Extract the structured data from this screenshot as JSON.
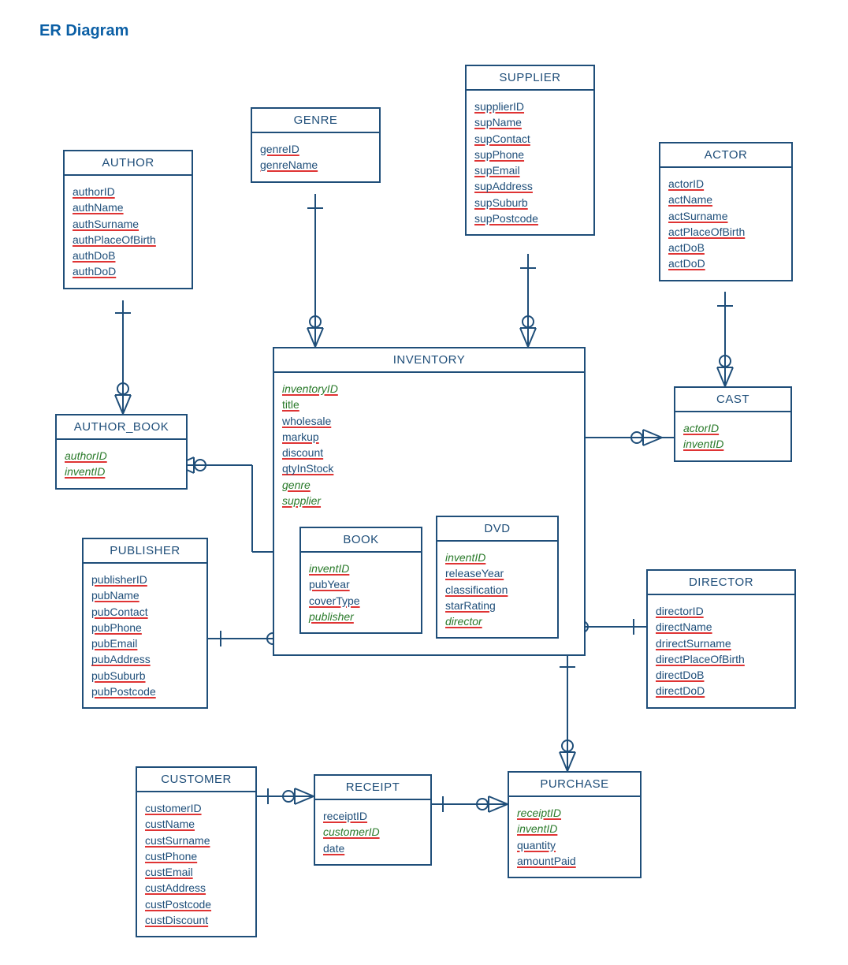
{
  "title": "ER Diagram",
  "entities": {
    "author": {
      "name": "AUTHOR",
      "attrs": [
        "authorID",
        "authName",
        "authSurname",
        "authPlaceOfBirth",
        "authDoB",
        "authDoD"
      ]
    },
    "genre": {
      "name": "GENRE",
      "attrs": [
        "genreID",
        "genreName"
      ]
    },
    "supplier": {
      "name": "SUPPLIER",
      "attrs": [
        "supplierID",
        "supName",
        "supContact",
        "supPhone",
        "supEmail",
        "supAddress",
        "supSuburb",
        "supPostcode"
      ]
    },
    "actor": {
      "name": "ACTOR",
      "attrs": [
        "actorID",
        "actName",
        "actSurname",
        "actPlaceOfBirth",
        "actDoB",
        "actDoD"
      ]
    },
    "author_book": {
      "name": "AUTHOR_BOOK",
      "attrs": [
        "authorID",
        "inventID"
      ]
    },
    "inventory": {
      "name": "INVENTORY",
      "attrs": [
        "inventoryID",
        "title",
        "wholesale",
        "markup",
        "discount",
        "qtyInStock",
        "genre",
        "supplier"
      ]
    },
    "book": {
      "name": "BOOK",
      "attrs": [
        "inventID",
        "pubYear",
        "coverType",
        "publisher"
      ]
    },
    "dvd": {
      "name": "DVD",
      "attrs": [
        "inventID",
        "releaseYear",
        "classification",
        "starRating",
        "director"
      ]
    },
    "cast": {
      "name": "CAST",
      "attrs": [
        "actorID",
        "inventID"
      ]
    },
    "publisher": {
      "name": "PUBLISHER",
      "attrs": [
        "publisherID",
        "pubName",
        "pubContact",
        "pubPhone",
        "pubEmail",
        "pubAddress",
        "pubSuburb",
        "pubPostcode"
      ]
    },
    "director": {
      "name": "DIRECTOR",
      "attrs": [
        "directorID",
        "directName",
        "drirectSurname",
        "directPlaceOfBirth",
        "directDoB",
        "directDoD"
      ]
    },
    "customer": {
      "name": "CUSTOMER",
      "attrs": [
        "customerID",
        "custName",
        "custSurname",
        "custPhone",
        "custEmail",
        "custAddress",
        "custPostcode",
        "custDiscount"
      ]
    },
    "receipt": {
      "name": "RECEIPT",
      "attrs": [
        "receiptID",
        "customerID",
        "date"
      ]
    },
    "purchase": {
      "name": "PURCHASE",
      "attrs": [
        "receiptID",
        "inventID",
        "quantity",
        "amountPaid"
      ]
    }
  },
  "chart_data": {
    "type": "diagram",
    "kind": "ER",
    "title": "ER Diagram",
    "entities": [
      {
        "name": "AUTHOR",
        "attributes": [
          "authorID",
          "authName",
          "authSurname",
          "authPlaceOfBirth",
          "authDoB",
          "authDoD"
        ],
        "primaryKey": [
          "authorID"
        ]
      },
      {
        "name": "GENRE",
        "attributes": [
          "genreID",
          "genreName"
        ],
        "primaryKey": [
          "genreID"
        ]
      },
      {
        "name": "SUPPLIER",
        "attributes": [
          "supplierID",
          "supName",
          "supContact",
          "supPhone",
          "supEmail",
          "supAddress",
          "supSuburb",
          "supPostcode"
        ],
        "primaryKey": [
          "supplierID"
        ]
      },
      {
        "name": "ACTOR",
        "attributes": [
          "actorID",
          "actName",
          "actSurname",
          "actPlaceOfBirth",
          "actDoB",
          "actDoD"
        ],
        "primaryKey": [
          "actorID"
        ]
      },
      {
        "name": "AUTHOR_BOOK",
        "attributes": [
          "authorID",
          "inventID"
        ],
        "primaryKey": [
          "authorID",
          "inventID"
        ],
        "foreignKeys": [
          "authorID",
          "inventID"
        ]
      },
      {
        "name": "INVENTORY",
        "attributes": [
          "inventoryID",
          "title",
          "wholesale",
          "markup",
          "discount",
          "qtyInStock",
          "genre",
          "supplier"
        ],
        "primaryKey": [
          "inventoryID"
        ],
        "foreignKeys": [
          "genre",
          "supplier"
        ]
      },
      {
        "name": "BOOK",
        "attributes": [
          "inventID",
          "pubYear",
          "coverType",
          "publisher"
        ],
        "primaryKey": [
          "inventID"
        ],
        "foreignKeys": [
          "inventID",
          "publisher"
        ],
        "subtypeOf": "INVENTORY"
      },
      {
        "name": "DVD",
        "attributes": [
          "inventID",
          "releaseYear",
          "classification",
          "starRating",
          "director"
        ],
        "primaryKey": [
          "inventID"
        ],
        "foreignKeys": [
          "inventID",
          "director"
        ],
        "subtypeOf": "INVENTORY"
      },
      {
        "name": "CAST",
        "attributes": [
          "actorID",
          "inventID"
        ],
        "primaryKey": [
          "actorID",
          "inventID"
        ],
        "foreignKeys": [
          "actorID",
          "inventID"
        ]
      },
      {
        "name": "PUBLISHER",
        "attributes": [
          "publisherID",
          "pubName",
          "pubContact",
          "pubPhone",
          "pubEmail",
          "pubAddress",
          "pubSuburb",
          "pubPostcode"
        ],
        "primaryKey": [
          "publisherID"
        ]
      },
      {
        "name": "DIRECTOR",
        "attributes": [
          "directorID",
          "directName",
          "drirectSurname",
          "directPlaceOfBirth",
          "directDoB",
          "directDoD"
        ],
        "primaryKey": [
          "directorID"
        ]
      },
      {
        "name": "CUSTOMER",
        "attributes": [
          "customerID",
          "custName",
          "custSurname",
          "custPhone",
          "custEmail",
          "custAddress",
          "custPostcode",
          "custDiscount"
        ],
        "primaryKey": [
          "customerID"
        ]
      },
      {
        "name": "RECEIPT",
        "attributes": [
          "receiptID",
          "customerID",
          "date"
        ],
        "primaryKey": [
          "receiptID"
        ],
        "foreignKeys": [
          "customerID"
        ]
      },
      {
        "name": "PURCHASE",
        "attributes": [
          "receiptID",
          "inventID",
          "quantity",
          "amountPaid"
        ],
        "primaryKey": [
          "receiptID",
          "inventID"
        ],
        "foreignKeys": [
          "receiptID",
          "inventID"
        ]
      }
    ],
    "relationships": [
      {
        "from": "AUTHOR",
        "to": "AUTHOR_BOOK",
        "cardinality": "1..*",
        "notation": "crowfoot"
      },
      {
        "from": "AUTHOR_BOOK",
        "to": "INVENTORY",
        "via": "BOOK",
        "cardinality": "*..1"
      },
      {
        "from": "GENRE",
        "to": "INVENTORY",
        "cardinality": "1..*"
      },
      {
        "from": "SUPPLIER",
        "to": "INVENTORY",
        "cardinality": "1..*"
      },
      {
        "from": "ACTOR",
        "to": "CAST",
        "cardinality": "1..*"
      },
      {
        "from": "CAST",
        "to": "DVD",
        "cardinality": "*..1"
      },
      {
        "from": "PUBLISHER",
        "to": "BOOK",
        "cardinality": "1..*"
      },
      {
        "from": "DIRECTOR",
        "to": "DVD",
        "cardinality": "1..*"
      },
      {
        "from": "CUSTOMER",
        "to": "RECEIPT",
        "cardinality": "1..*"
      },
      {
        "from": "RECEIPT",
        "to": "PURCHASE",
        "cardinality": "1..*"
      },
      {
        "from": "PURCHASE",
        "to": "INVENTORY",
        "cardinality": "*..1"
      }
    ]
  }
}
